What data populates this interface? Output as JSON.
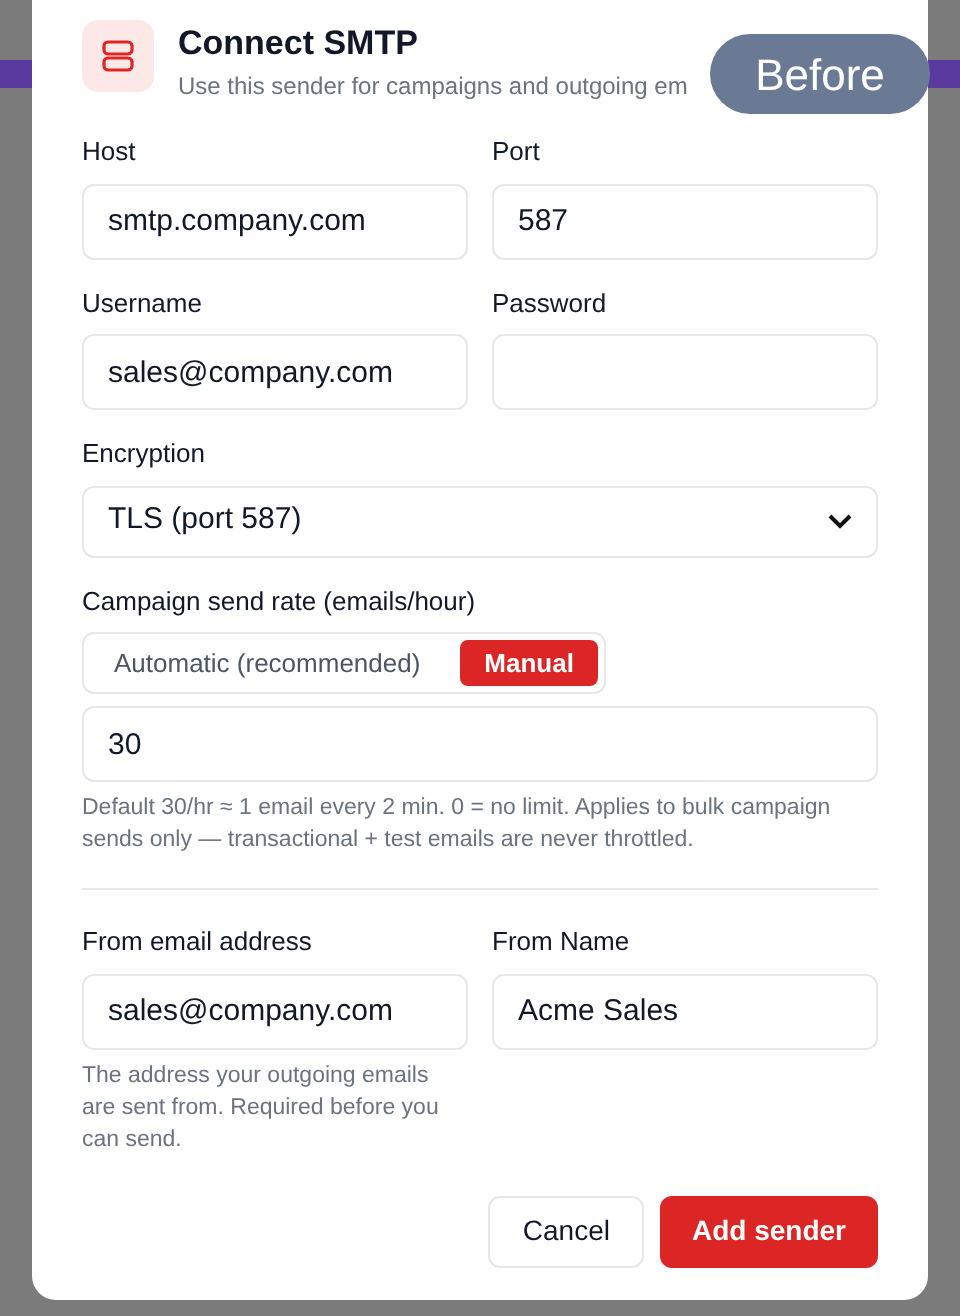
{
  "dialog": {
    "title": "Connect SMTP",
    "subtitle": "Use this sender for campaigns and outgoing em"
  },
  "overlay_badge": "Before",
  "host": {
    "label": "Host",
    "value": "smtp.company.com"
  },
  "port": {
    "label": "Port",
    "value": "587"
  },
  "username": {
    "label": "Username",
    "value": "sales@company.com"
  },
  "password": {
    "label": "Password"
  },
  "encryption": {
    "label": "Encryption",
    "value": "TLS (port 587)"
  },
  "send_rate": {
    "label": "Campaign send rate (emails/hour)",
    "modes": [
      {
        "label": "Automatic (recommended)",
        "selected": false
      },
      {
        "label": "Manual",
        "selected": true
      }
    ],
    "value": "30",
    "help": "Default 30/hr ≈ 1 email every 2 min. 0 = no limit. Applies to bulk campaign sends only — transactional + test emails are never throttled."
  },
  "from_email": {
    "label": "From email address",
    "value": "sales@company.com",
    "help": "The address your outgoing emails are sent from. Required before you can send."
  },
  "from_name": {
    "label": "From Name",
    "value": "Acme Sales"
  },
  "buttons": [
    {
      "label": "Cancel",
      "kind": "secondary"
    },
    {
      "label": "Add sender",
      "kind": "primary"
    }
  ]
}
